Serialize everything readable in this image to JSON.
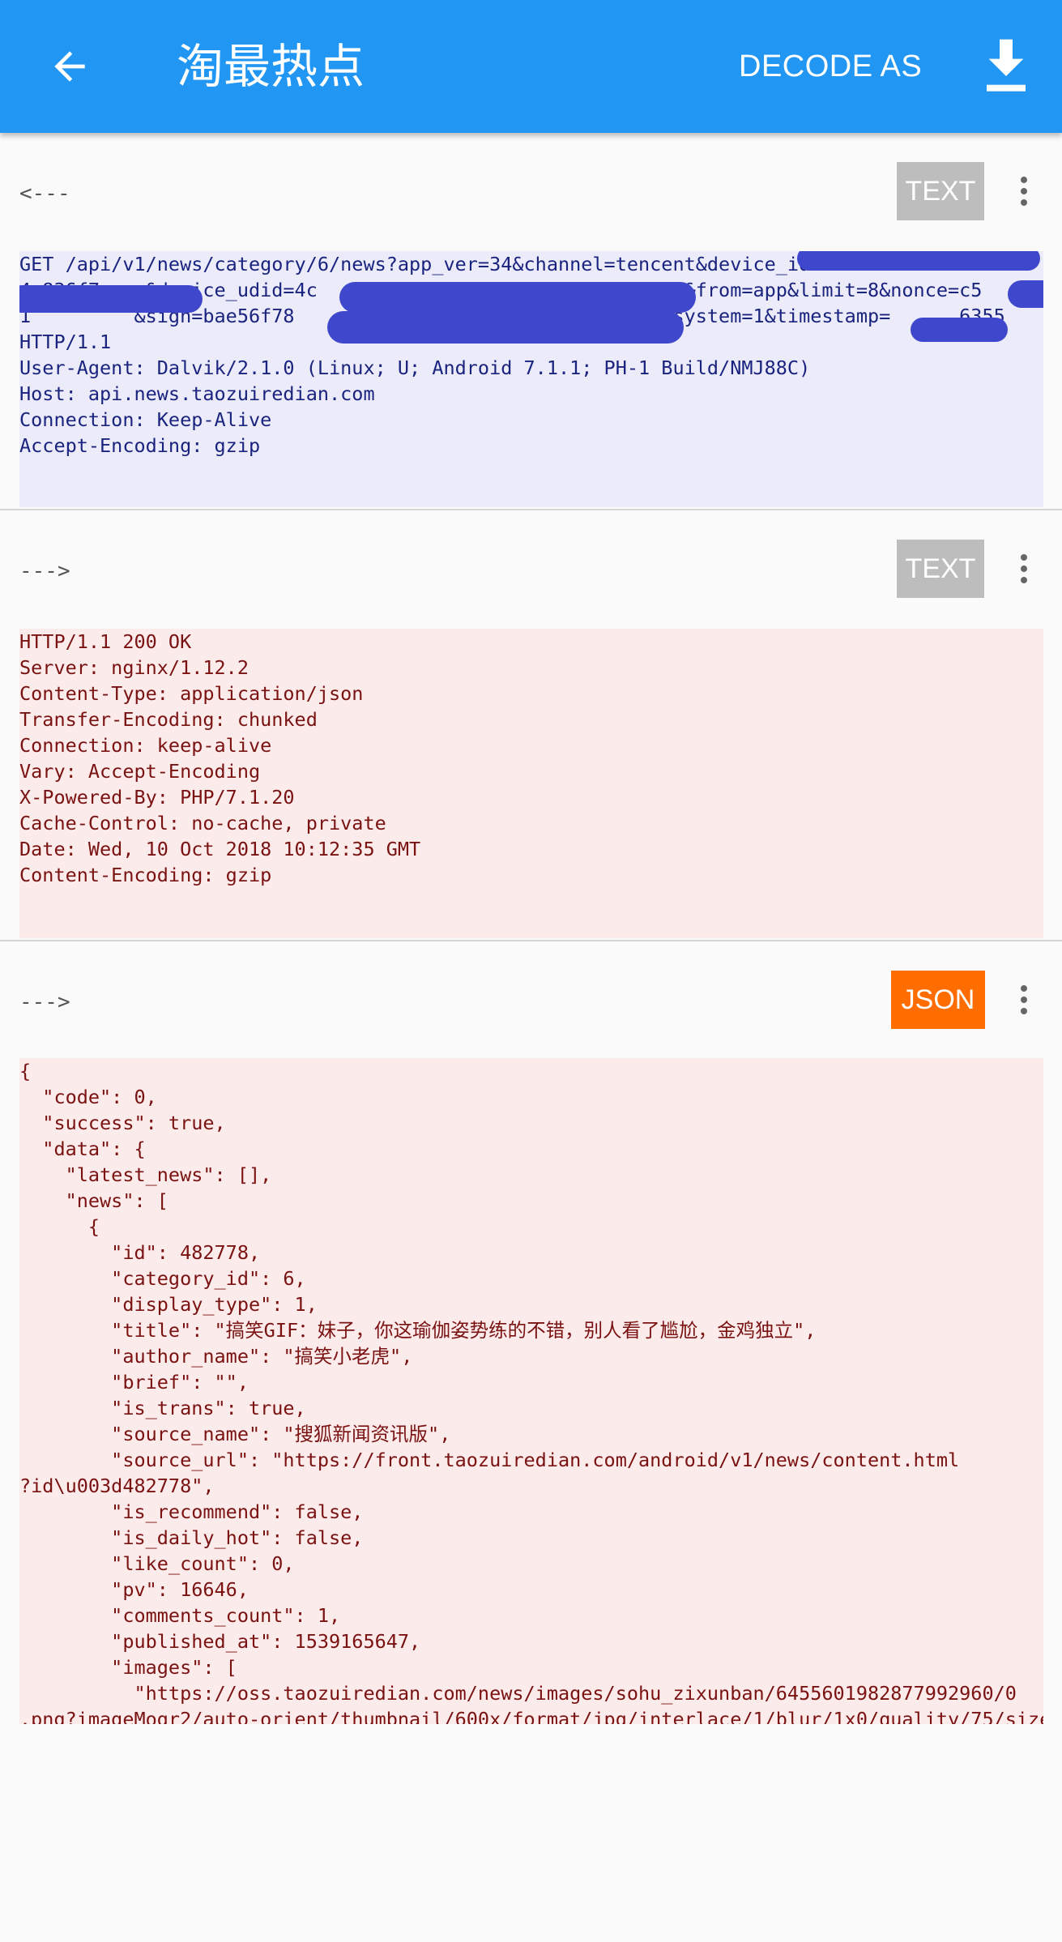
{
  "appbar": {
    "title": "淘最热点",
    "decode_label": "DECODE AS",
    "back_icon": "arrow-back-icon",
    "download_icon": "download-icon",
    "color": "#2196f3"
  },
  "request": {
    "direction": "<---",
    "format": "TEXT",
    "body": "GET /api/v1/news/category/6/news?app_ver=34&channel=tencent&device_id\n4c836f7    &device_udid=4c                              52&from=app&limit=8&nonce=c5\n1         &sign=bae56f78                              e9&system=1&timestamp=      6355\nHTTP/1.1\nUser-Agent: Dalvik/2.1.0 (Linux; U; Android 7.1.1; PH-1 Build/NMJ88C)\nHost: api.news.taozuiredian.com\nConnection: Keep-Alive\nAccept-Encoding: gzip"
  },
  "response_headers": {
    "direction": "--->",
    "format": "TEXT",
    "body": "HTTP/1.1 200 OK\nServer: nginx/1.12.2\nContent-Type: application/json\nTransfer-Encoding: chunked\nConnection: keep-alive\nVary: Accept-Encoding\nX-Powered-By: PHP/7.1.20\nCache-Control: no-cache, private\nDate: Wed, 10 Oct 2018 10:12:35 GMT\nContent-Encoding: gzip"
  },
  "response_body": {
    "direction": "--->",
    "format": "JSON",
    "format_color": "#ff6d00",
    "body": "{\n  \"code\": 0,\n  \"success\": true,\n  \"data\": {\n    \"latest_news\": [],\n    \"news\": [\n      {\n        \"id\": 482778,\n        \"category_id\": 6,\n        \"display_type\": 1,\n        \"title\": \"搞笑GIF：妹子，你这瑜伽姿势练的不错，别人看了尴尬，金鸡独立\",\n        \"author_name\": \"搞笑小老虎\",\n        \"brief\": \"\",\n        \"is_trans\": true,\n        \"source_name\": \"搜狐新闻资讯版\",\n        \"source_url\": \"https://front.taozuiredian.com/android/v1/news/content.html\n?id\\u003d482778\",\n        \"is_recommend\": false,\n        \"is_daily_hot\": false,\n        \"like_count\": 0,\n        \"pv\": 16646,\n        \"comments_count\": 1,\n        \"published_at\": 1539165647,\n        \"images\": [\n          \"https://oss.taozuiredian.com/news/images/sohu_zixunban/6455601982877992960/0\n.png?imageMogr2/auto-orient/thumbnail/600x/format/jpg/interlace/1/blur/1x0/quality/75/size"
  }
}
